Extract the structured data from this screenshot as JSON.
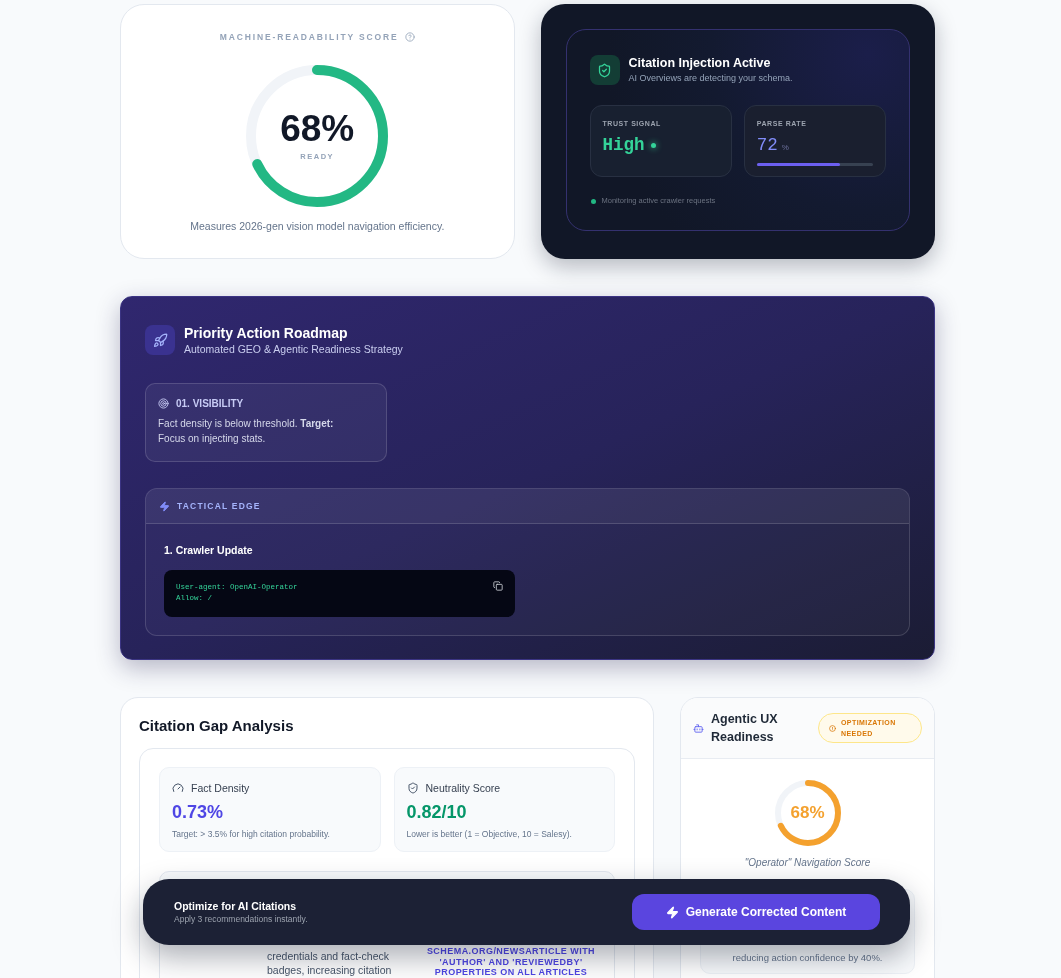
{
  "readability_card": {
    "title": "MACHINE-READABILITY SCORE",
    "score": "68%",
    "level": 0.68,
    "status": "READY",
    "caption": "Measures 2026-gen vision model navigation efficiency."
  },
  "citation_status_card": {
    "title": "Citation Injection Active",
    "subtitle": "AI Overviews are detecting your schema.",
    "stats": [
      {
        "kind": "signal",
        "label": "TRUST SIGNAL",
        "value": "High"
      },
      {
        "kind": "rate",
        "label": "PARSE RATE",
        "value": "72",
        "unit": "%",
        "level": 0.72
      }
    ],
    "footer": "Monitoring active crawler requests"
  },
  "roadmap": {
    "title": "Priority Action Roadmap",
    "subtitle": "Automated GEO & Agentic Readiness Strategy",
    "items": [
      {
        "heading": "01. VISIBILITY",
        "text": "Fact density is below threshold. **Target:** Focus on injecting stats."
      }
    ],
    "tactical_edge": {
      "title": "TACTICAL EDGE",
      "steps": [
        {
          "title": "1. Crawler Update",
          "code": [
            "User-agent: OpenAI-Operator",
            "Allow: /"
          ]
        }
      ]
    }
  },
  "citation_gap": {
    "title": "Citation Gap Analysis",
    "metrics": [
      {
        "kind": "density",
        "label": "Fact Density",
        "value": "0.73%",
        "note": "Target: > 3.5% for high citation probability."
      },
      {
        "kind": "neutrality",
        "label": "Neutrality Score",
        "value": "0.82/10",
        "note": "Lower is better (1 = Objective, 10 = Salesy)."
      }
    ],
    "table_rows": [
      {
        "column_2": "credentials and fact-check badges, increasing citation",
        "column_3": "SCHEMA.ORG/NEWSARTICLE WITH 'AUTHOR' AND 'REVIEWEDBY' PROPERTIES ON ALL ARTICLES"
      }
    ]
  },
  "agentic_ux": {
    "title": "Agentic UX Readiness",
    "badge": "OPTIMIZATION NEEDED",
    "score": "68%",
    "level": 0.68,
    "caption": "\"Operator\" Navigation Score",
    "note": "reducing action confidence by 40%."
  },
  "action_bar": {
    "title": "Optimize for AI Citations",
    "subtitle": "Apply 3 recommendations instantly.",
    "button": "Generate Corrected Content"
  }
}
